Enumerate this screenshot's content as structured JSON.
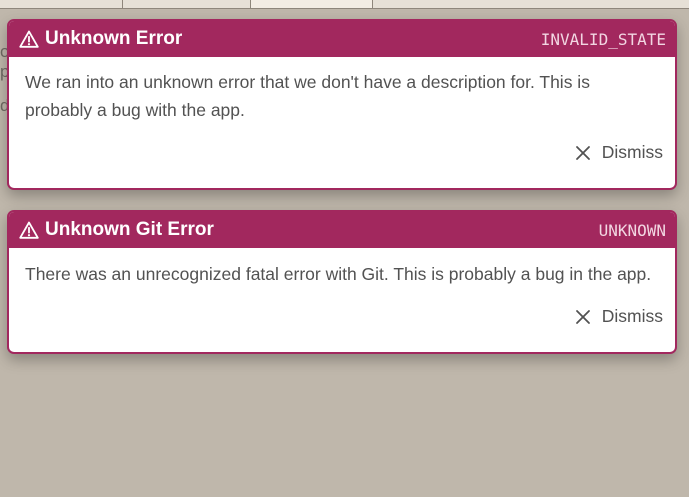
{
  "toasts": [
    {
      "title": "Unknown Error",
      "code": "INVALID_STATE",
      "message": "We ran into an unknown error that we don't have a description for. This is probably a bug with the app.",
      "dismiss_label": "Dismiss"
    },
    {
      "title": "Unknown Git Error",
      "code": "UNKNOWN",
      "message": "There was an unrecognized fatal error with Git. This is probably a bug in the app.",
      "dismiss_label": "Dismiss"
    }
  ],
  "colors": {
    "accent": "#a2285e",
    "overlay_background": "#bfb7ab",
    "text": "#525252"
  },
  "icons": {
    "header_icon": "warning-triangle-icon",
    "dismiss_icon": "close-icon"
  }
}
